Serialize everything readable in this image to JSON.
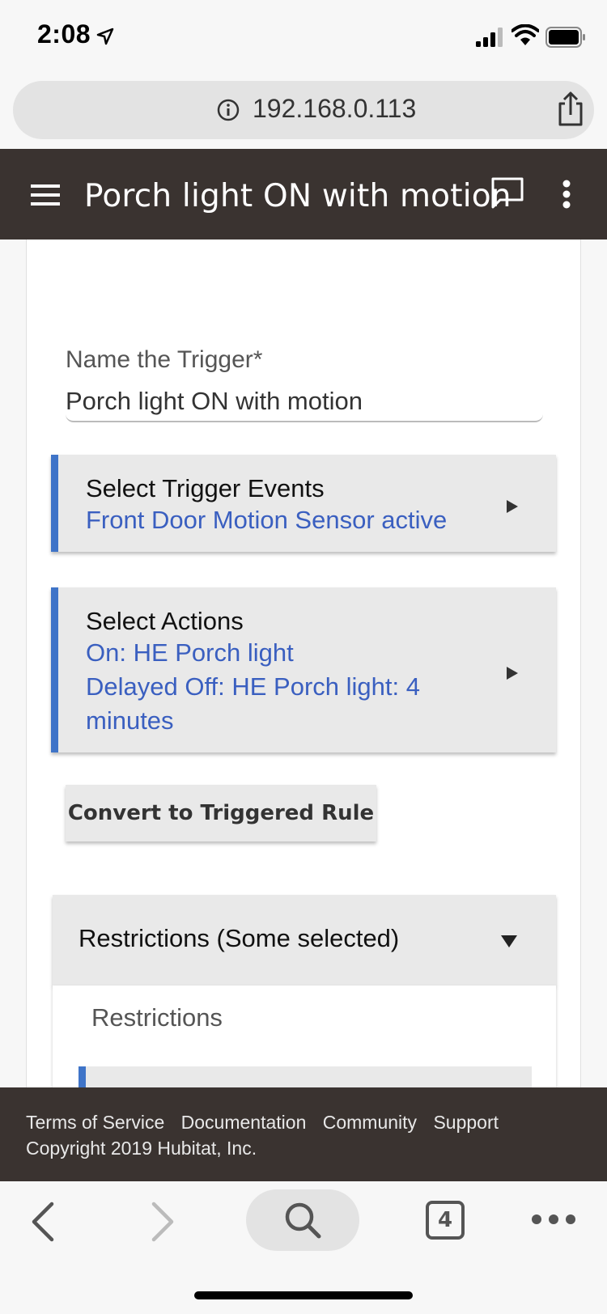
{
  "status_bar": {
    "time": "2:08"
  },
  "browser": {
    "url": "192.168.0.113",
    "tab_count": "4"
  },
  "header": {
    "title": "Porch light ON with motion"
  },
  "form": {
    "name_label": "Name the Trigger*",
    "name_value": "Porch light ON with motion",
    "trigger_events": {
      "title": "Select Trigger Events",
      "value": "Front Door Motion Sensor active"
    },
    "actions": {
      "title": "Select Actions",
      "lines": [
        "On: HE Porch light",
        "Delayed Off: HE Porch light: 4",
        "minutes"
      ]
    },
    "convert_button": "Convert to Triggered Rule",
    "restrictions": {
      "title": "Restrictions (Some selected)",
      "subtitle": "Restrictions"
    }
  },
  "footer": {
    "links": [
      "Terms of Service",
      "Documentation",
      "Community",
      "Support"
    ],
    "copyright": "Copyright 2019 Hubitat, Inc."
  },
  "colors": {
    "header_bg": "#3a3330",
    "accent_blue": "#3f74c8",
    "link_blue": "#3a5fc0"
  }
}
